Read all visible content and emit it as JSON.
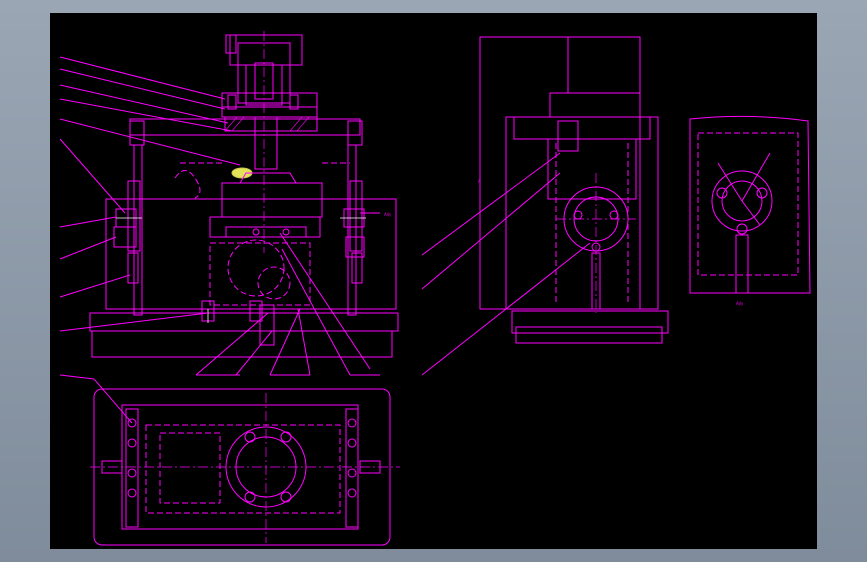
{
  "drawing": {
    "background_color": "#000000",
    "line_color": "#ff00ff",
    "frame_color": "#8f9bab",
    "labels": {
      "front_view_dim": "A向",
      "detail_view": "A向",
      "side_note": "A"
    }
  }
}
